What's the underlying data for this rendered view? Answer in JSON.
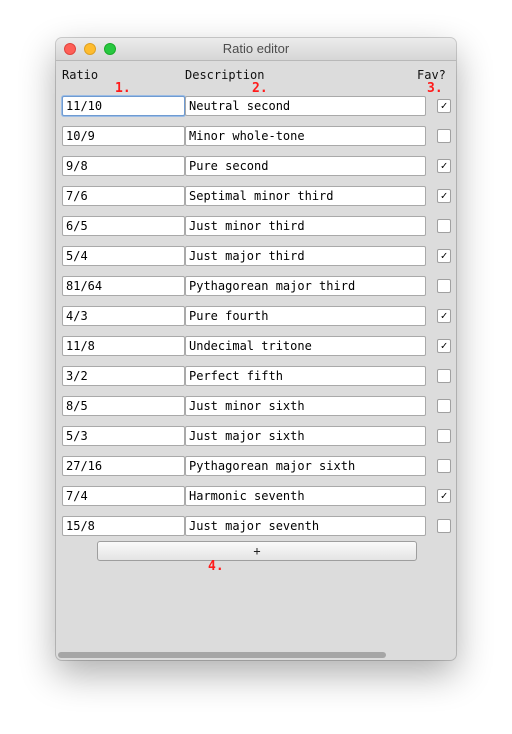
{
  "window": {
    "title": "Ratio editor"
  },
  "headers": {
    "ratio": "Ratio",
    "description": "Description",
    "fav": "Fav?"
  },
  "annotations": [
    "1.",
    "2.",
    "3.",
    "4."
  ],
  "rows": [
    {
      "ratio": "11/10",
      "description": "Neutral second",
      "fav": true
    },
    {
      "ratio": "10/9",
      "description": "Minor whole-tone",
      "fav": false
    },
    {
      "ratio": "9/8",
      "description": "Pure second",
      "fav": true
    },
    {
      "ratio": "7/6",
      "description": "Septimal minor third",
      "fav": true
    },
    {
      "ratio": "6/5",
      "description": "Just minor third",
      "fav": false
    },
    {
      "ratio": "5/4",
      "description": "Just major third",
      "fav": true
    },
    {
      "ratio": "81/64",
      "description": "Pythagorean major third",
      "fav": false
    },
    {
      "ratio": "4/3",
      "description": "Pure fourth",
      "fav": true
    },
    {
      "ratio": "11/8",
      "description": "Undecimal tritone",
      "fav": true
    },
    {
      "ratio": "3/2",
      "description": "Perfect fifth",
      "fav": false
    },
    {
      "ratio": "8/5",
      "description": "Just minor sixth",
      "fav": false
    },
    {
      "ratio": "5/3",
      "description": "Just major sixth",
      "fav": false
    },
    {
      "ratio": "27/16",
      "description": "Pythagorean major sixth",
      "fav": false
    },
    {
      "ratio": "7/4",
      "description": "Harmonic seventh",
      "fav": true
    },
    {
      "ratio": "15/8",
      "description": "Just major seventh",
      "fav": false
    }
  ],
  "add_button": {
    "label": "+"
  },
  "check_glyph": "✓"
}
